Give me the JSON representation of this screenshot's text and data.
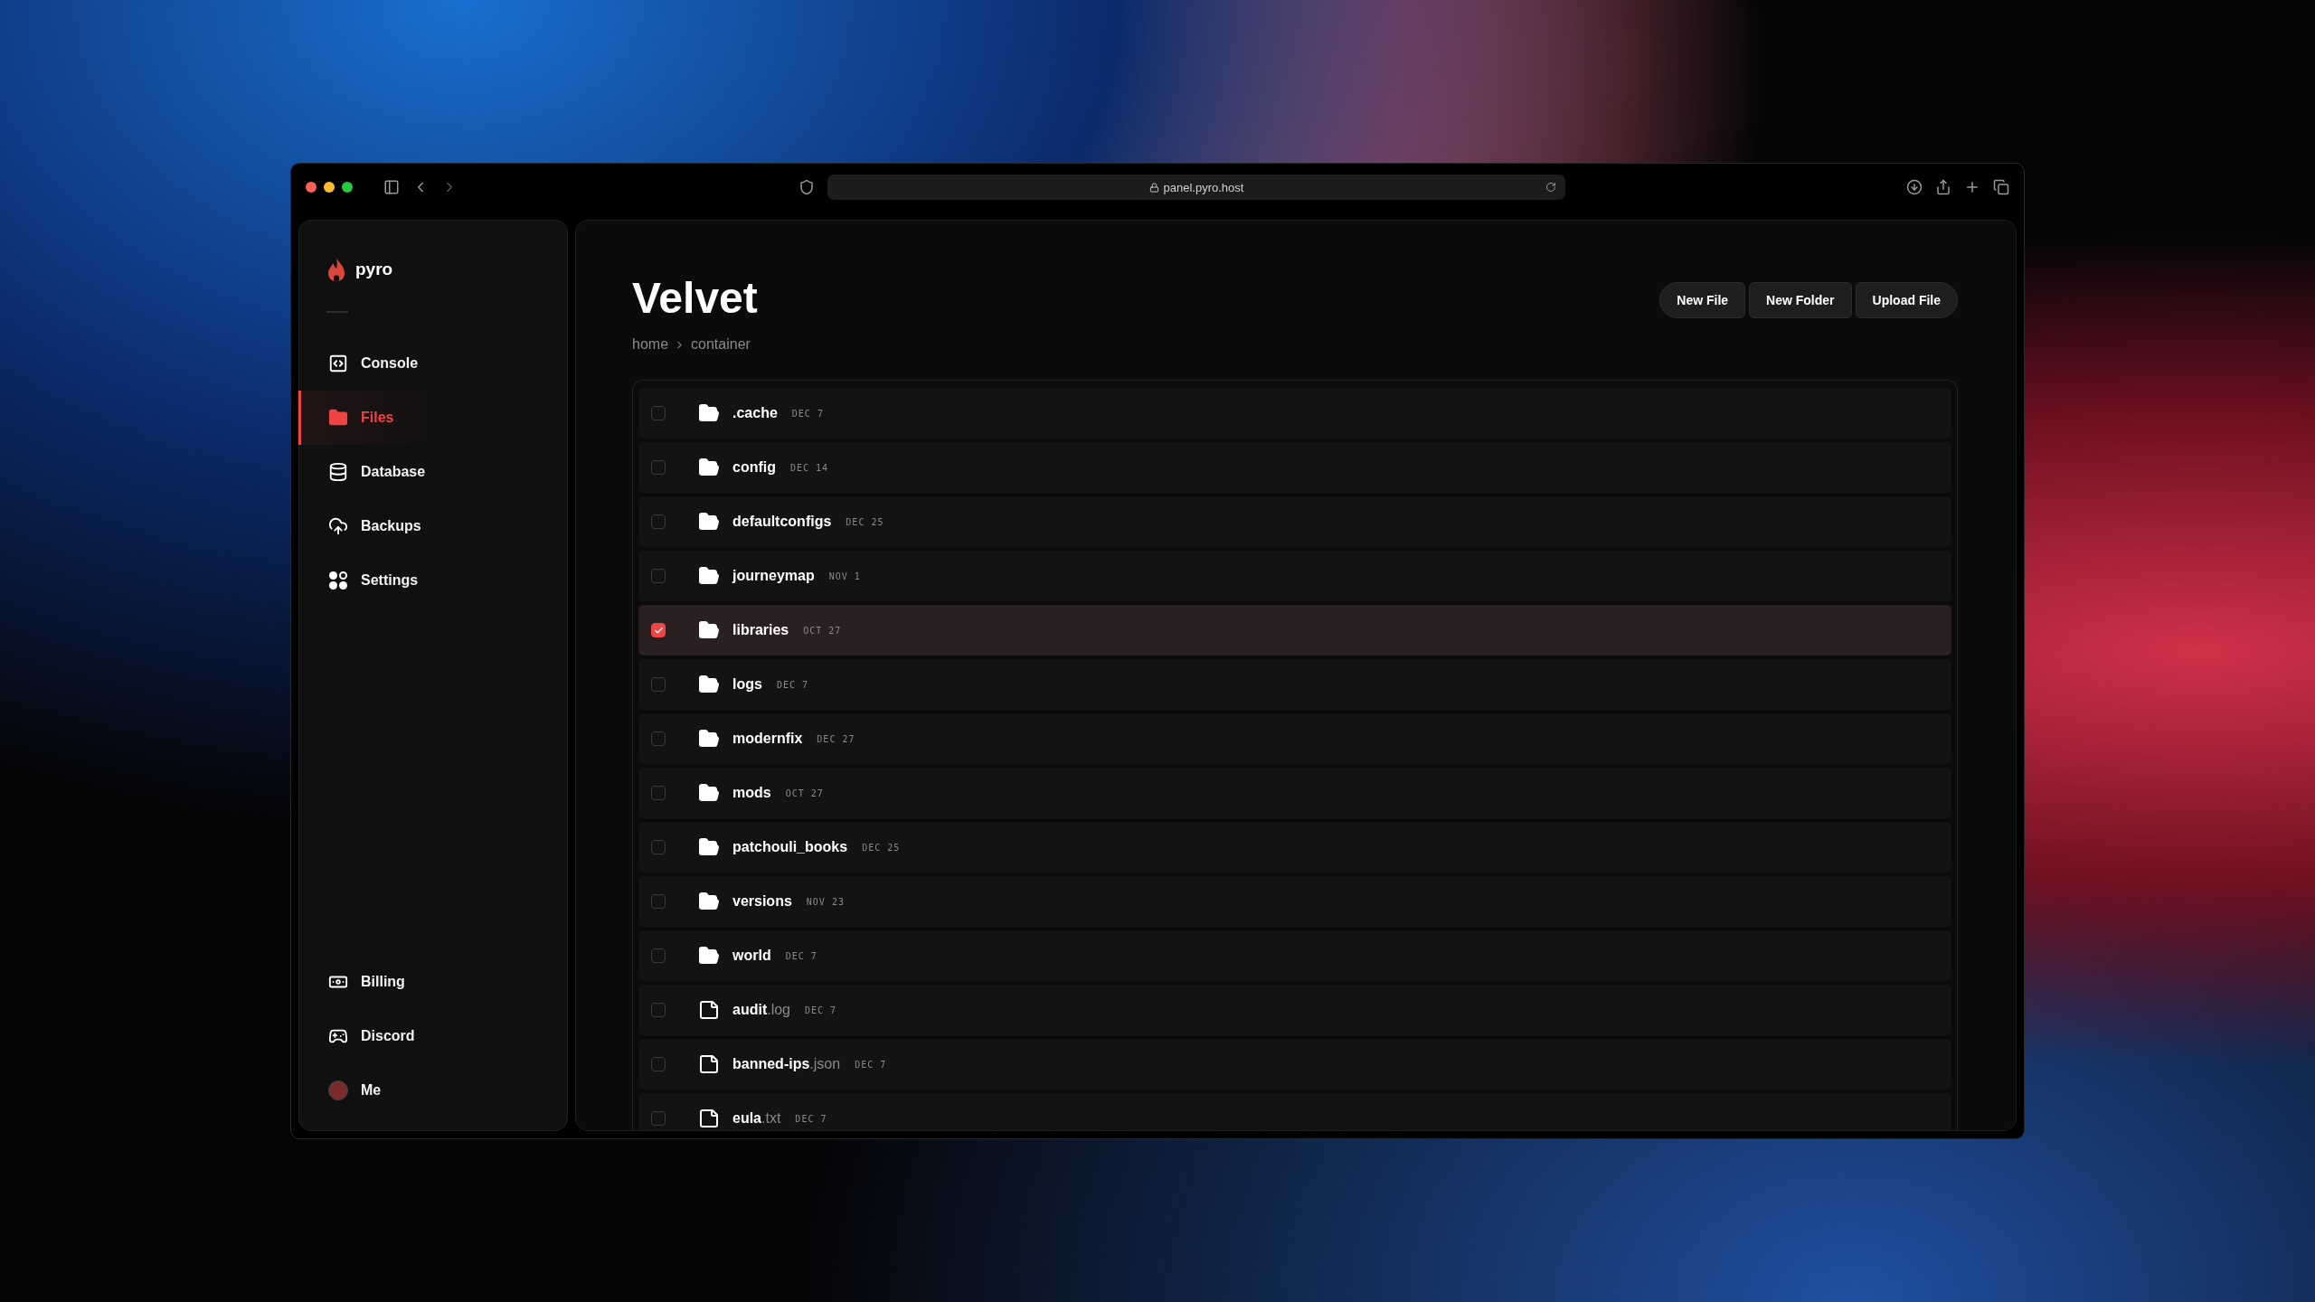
{
  "browser": {
    "url": "panel.pyro.host"
  },
  "sidebar": {
    "logo": "pyro",
    "items": [
      {
        "kind": "console",
        "label": "Console",
        "selected": false
      },
      {
        "kind": "files",
        "label": "Files",
        "selected": true
      },
      {
        "kind": "database",
        "label": "Database",
        "selected": false
      },
      {
        "kind": "backups",
        "label": "Backups",
        "selected": false
      },
      {
        "kind": "settings",
        "label": "Settings",
        "selected": false
      }
    ],
    "bottom_items": [
      {
        "kind": "billing",
        "label": "Billing"
      },
      {
        "kind": "discord",
        "label": "Discord"
      },
      {
        "kind": "avatar",
        "label": "Me"
      }
    ]
  },
  "page": {
    "title": "Velvet",
    "breadcrumb": [
      "home",
      "container"
    ],
    "actions": [
      "New File",
      "New Folder",
      "Upload File"
    ]
  },
  "files": [
    {
      "kind": "folder",
      "name": ".cache",
      "date": "DEC 7",
      "checked": false,
      "selected": false
    },
    {
      "kind": "folder",
      "name": "config",
      "date": "DEC 14",
      "checked": false,
      "selected": false
    },
    {
      "kind": "folder",
      "name": "defaultconfigs",
      "date": "DEC 25",
      "checked": false,
      "selected": false
    },
    {
      "kind": "folder",
      "name": "journeymap",
      "date": "NOV 1",
      "checked": false,
      "selected": false
    },
    {
      "kind": "folder",
      "name": "libraries",
      "date": "OCT 27",
      "checked": true,
      "selected": true
    },
    {
      "kind": "folder",
      "name": "logs",
      "date": "DEC 7",
      "checked": false,
      "selected": false
    },
    {
      "kind": "folder",
      "name": "modernfix",
      "date": "DEC 27",
      "checked": false,
      "selected": false
    },
    {
      "kind": "folder",
      "name": "mods",
      "date": "OCT 27",
      "checked": false,
      "selected": false
    },
    {
      "kind": "folder",
      "name": "patchouli_books",
      "date": "DEC 25",
      "checked": false,
      "selected": false
    },
    {
      "kind": "folder",
      "name": "versions",
      "date": "NOV 23",
      "checked": false,
      "selected": false
    },
    {
      "kind": "folder",
      "name": "world",
      "date": "DEC 7",
      "checked": false,
      "selected": false
    },
    {
      "kind": "file",
      "name": "audit",
      "extension": ".log",
      "date": "DEC 7",
      "checked": false,
      "selected": false
    },
    {
      "kind": "file",
      "name": "banned-ips",
      "extension": ".json",
      "date": "DEC 7",
      "checked": false,
      "selected": false
    },
    {
      "kind": "file",
      "name": "eula",
      "extension": ".txt",
      "date": "DEC 7",
      "checked": false,
      "selected": false
    }
  ]
}
